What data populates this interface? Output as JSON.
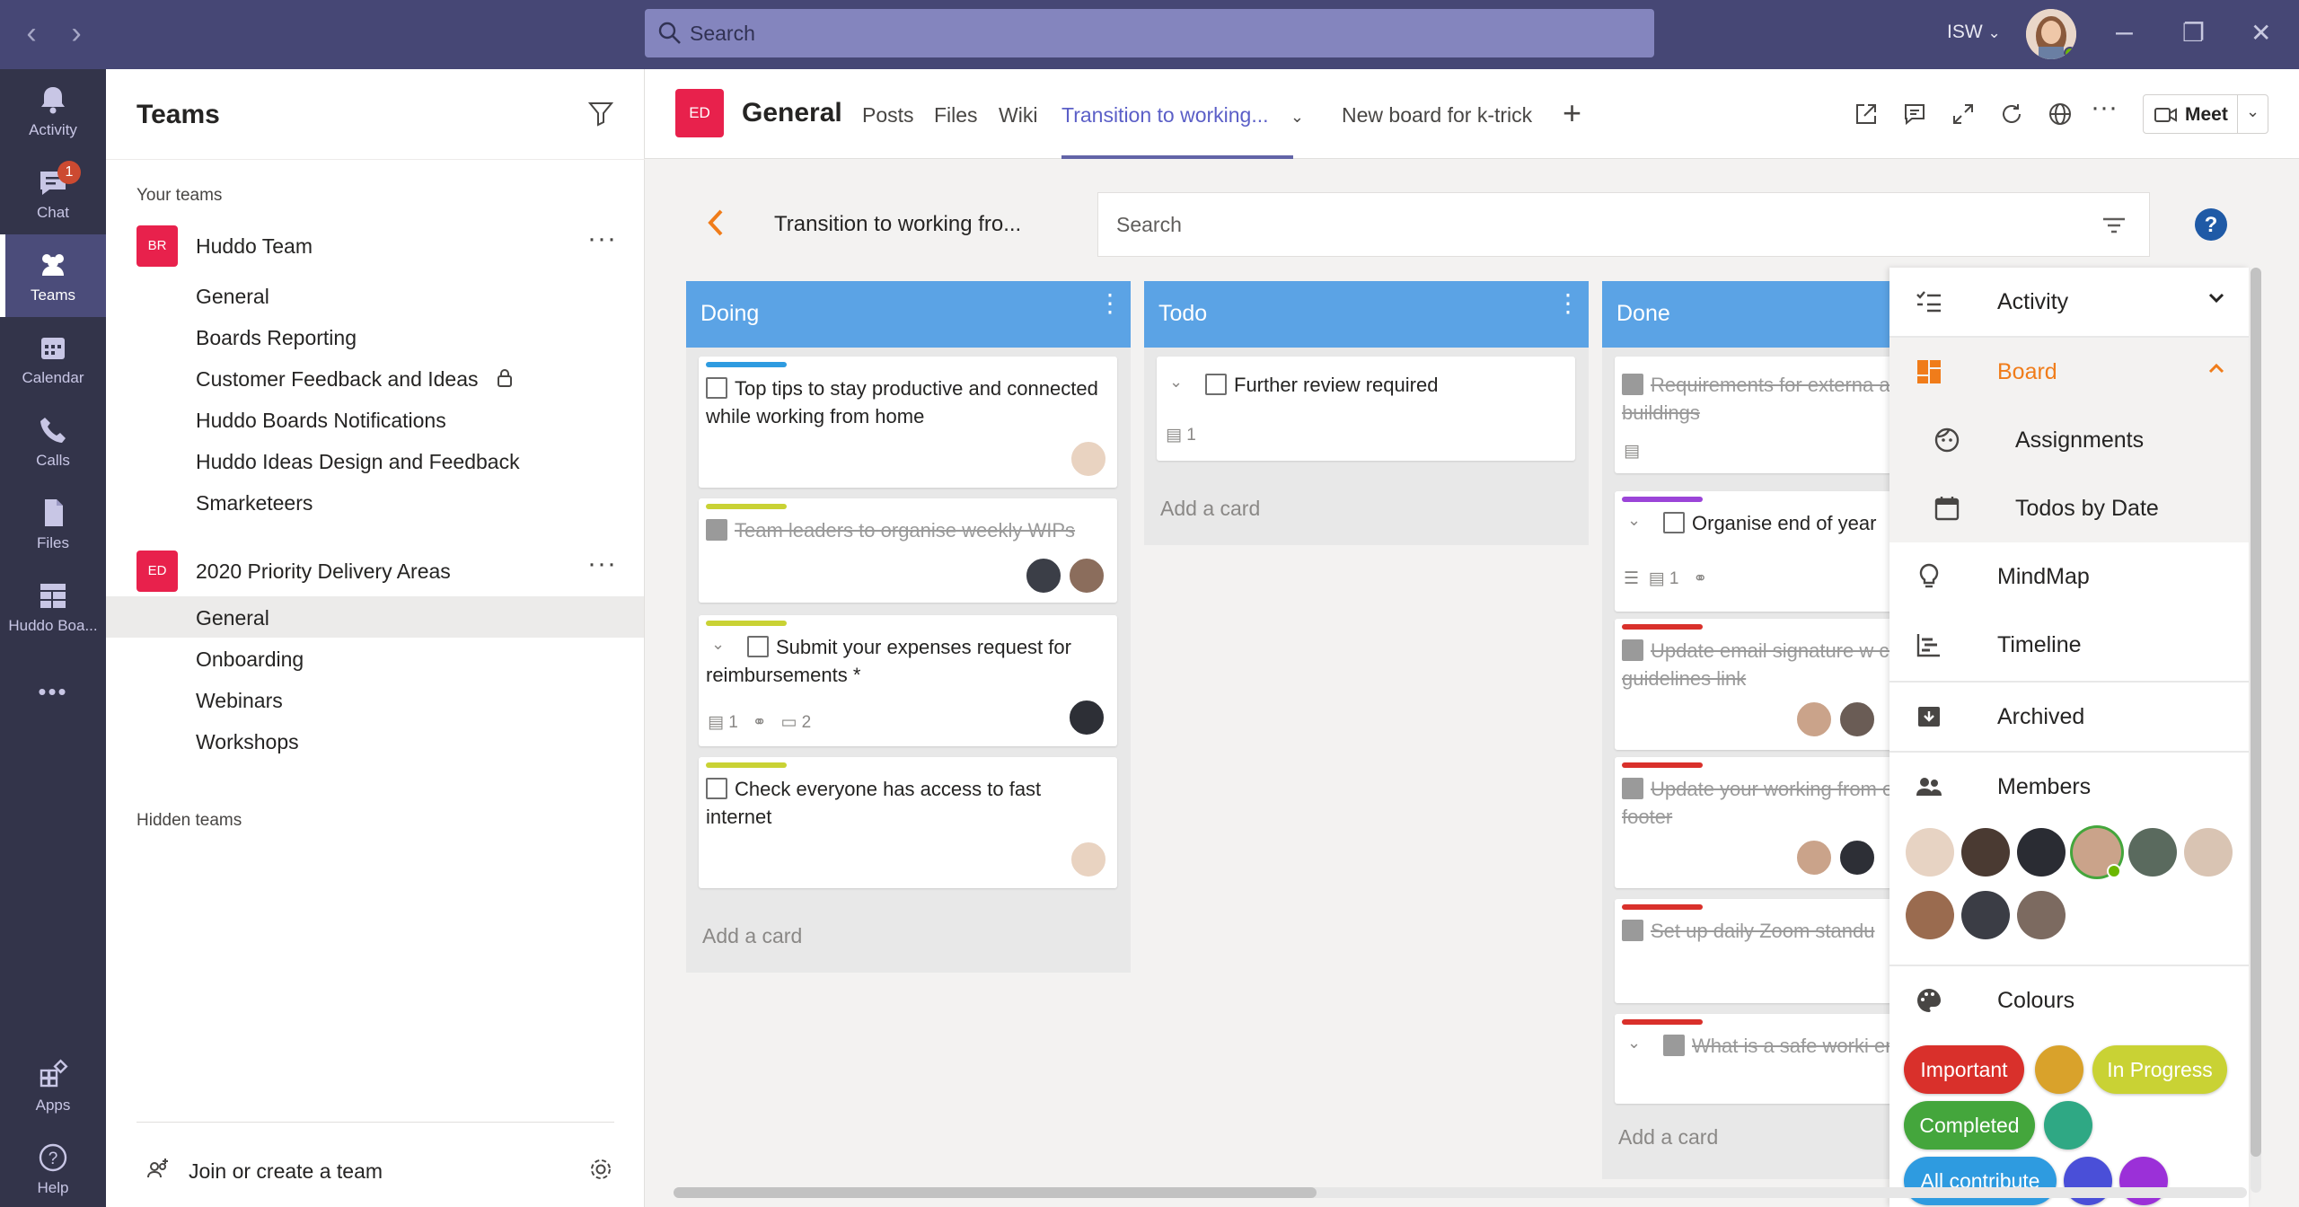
{
  "titlebar": {
    "search_placeholder": "Search",
    "tenant": "ISW",
    "tenant_chevron": "⌄"
  },
  "rail": {
    "items": [
      {
        "label": "Activity",
        "icon": "bell-icon"
      },
      {
        "label": "Chat",
        "icon": "chat-icon",
        "badge": "1"
      },
      {
        "label": "Teams",
        "icon": "teams-icon"
      },
      {
        "label": "Calendar",
        "icon": "calendar-icon"
      },
      {
        "label": "Calls",
        "icon": "phone-icon"
      },
      {
        "label": "Files",
        "icon": "file-icon"
      },
      {
        "label": "Huddo Boa...",
        "icon": "huddo-boards-icon"
      },
      {
        "label": "Apps",
        "icon": "apps-icon"
      },
      {
        "label": "Help",
        "icon": "help-icon"
      }
    ],
    "more": "•••"
  },
  "teams_panel": {
    "title": "Teams",
    "your_teams_label": "Your teams",
    "hidden_teams_label": "Hidden teams",
    "join_label": "Join or create a team",
    "teams": [
      {
        "initials": "BR",
        "name": "Huddo Team",
        "channels": [
          "General",
          "Boards Reporting",
          "Customer Feedback and Ideas",
          "Huddo Boards Notifications",
          "Huddo Ideas Design and Feedback",
          "Smarketeers"
        ]
      },
      {
        "initials": "ED",
        "name": "2020 Priority Delivery Areas",
        "channels": [
          "General",
          "Onboarding",
          "Webinars",
          "Workshops"
        ]
      }
    ]
  },
  "channel_header": {
    "avatar": "ED",
    "title": "General",
    "tabs": [
      "Posts",
      "Files",
      "Wiki",
      "Transition to working...",
      "New board for k-trick"
    ],
    "active_tab": "Transition to working...",
    "meet_label": "Meet"
  },
  "board": {
    "title": "Transition to working fro...",
    "search_placeholder": "Search",
    "add_card": "Add a card",
    "columns": [
      {
        "name": "Doing",
        "cards": [
          {
            "text": "Top tips to stay productive and connected while working from home",
            "color": "#2e9be0",
            "done": false
          },
          {
            "text": "Team leaders to organise weekly WIPs",
            "color": "#c9d234",
            "done": true
          },
          {
            "text": "Submit your expenses request for reimbursements *",
            "color": "#c9d234",
            "done": false,
            "comments": "1",
            "subtasks": "2"
          },
          {
            "text": "Check everyone has access to fast internet",
            "color": "#c9d234",
            "done": false
          }
        ]
      },
      {
        "name": "Todo",
        "cards": [
          {
            "text": "Further review required",
            "done": false,
            "comments": "1"
          }
        ]
      },
      {
        "name": "Done",
        "cards": [
          {
            "text": "Requirements for externa access to council buildings",
            "done": true
          },
          {
            "text": "Organise end of year",
            "color": "#9b44d8",
            "done": false,
            "comments": "1"
          },
          {
            "text": "Update email signature w company guidelines link",
            "color": "#d9302b",
            "done": true
          },
          {
            "text": "Update your working from on your email footer",
            "color": "#d9302b",
            "done": true
          },
          {
            "text": "Set up daily Zoom standu",
            "color": "#d9302b",
            "done": true
          },
          {
            "text": "What is a safe worki environment?",
            "color": "#d9302b",
            "done": true
          }
        ]
      }
    ]
  },
  "side_panel": {
    "activity": "Activity",
    "board": "Board",
    "assignments": "Assignments",
    "todos_by_date": "Todos by Date",
    "mindmap": "MindMap",
    "timeline": "Timeline",
    "archived": "Archived",
    "members": "Members",
    "colours": "Colours",
    "colour_pills": [
      {
        "label": "Important",
        "color": "#d9302b"
      },
      {
        "label": "",
        "color": "#d9a22b"
      },
      {
        "label": "In Progress",
        "color": "#c9d234"
      },
      {
        "label": "Completed",
        "color": "#44a63c"
      },
      {
        "label": "",
        "color": "#2fa884"
      },
      {
        "label": "All contribute",
        "color": "#2e9be0"
      },
      {
        "label": "",
        "color": "#4a4fd8"
      },
      {
        "label": "",
        "color": "#9b30d8"
      }
    ],
    "accent": "#f07c1a"
  },
  "colors": {
    "titlebar": "#464775",
    "rail": "#33344a",
    "column_header": "#5ba3e5",
    "brand_red": "#e8214c"
  }
}
